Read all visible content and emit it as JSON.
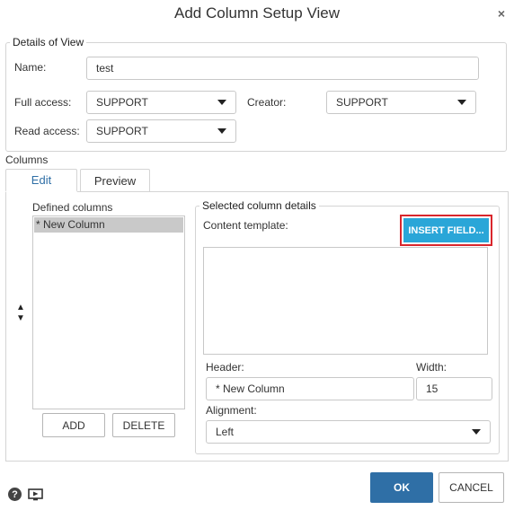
{
  "dialog": {
    "title": "Add Column Setup View",
    "close_glyph": "×"
  },
  "details": {
    "legend": "Details of View",
    "name_label": "Name:",
    "name_value": "test",
    "full_access_label": "Full access:",
    "full_access_value": "SUPPORT",
    "creator_label": "Creator:",
    "creator_value": "SUPPORT",
    "read_access_label": "Read access:",
    "read_access_value": "SUPPORT"
  },
  "columns": {
    "label": "Columns",
    "tabs": [
      {
        "label": "Edit",
        "active": true
      },
      {
        "label": "Preview",
        "active": false
      }
    ],
    "defined_label": "Defined columns",
    "defined_items": [
      "* New Column"
    ],
    "up_glyph": "▲",
    "down_glyph": "▼",
    "add_label": "ADD",
    "delete_label": "DELETE"
  },
  "selected": {
    "legend": "Selected column details",
    "content_template_label": "Content template:",
    "insert_field_label": "INSERT FIELD...",
    "content_template_value": "",
    "header_label": "Header:",
    "header_value": "* New Column",
    "width_label": "Width:",
    "width_value": "15",
    "alignment_label": "Alignment:",
    "alignment_value": "Left"
  },
  "footer": {
    "ok_label": "OK",
    "cancel_label": "CANCEL",
    "help_glyph": "?",
    "icons": [
      "help-icon",
      "video-tutorial-icon"
    ]
  },
  "colors": {
    "primary": "#2f6fa6",
    "insert_field_bg": "#2aa6d8",
    "insert_field_outline": "#d9262c",
    "edit_tab_text": "#2f6fa6",
    "selected_row_bg": "#c9c9c9"
  }
}
